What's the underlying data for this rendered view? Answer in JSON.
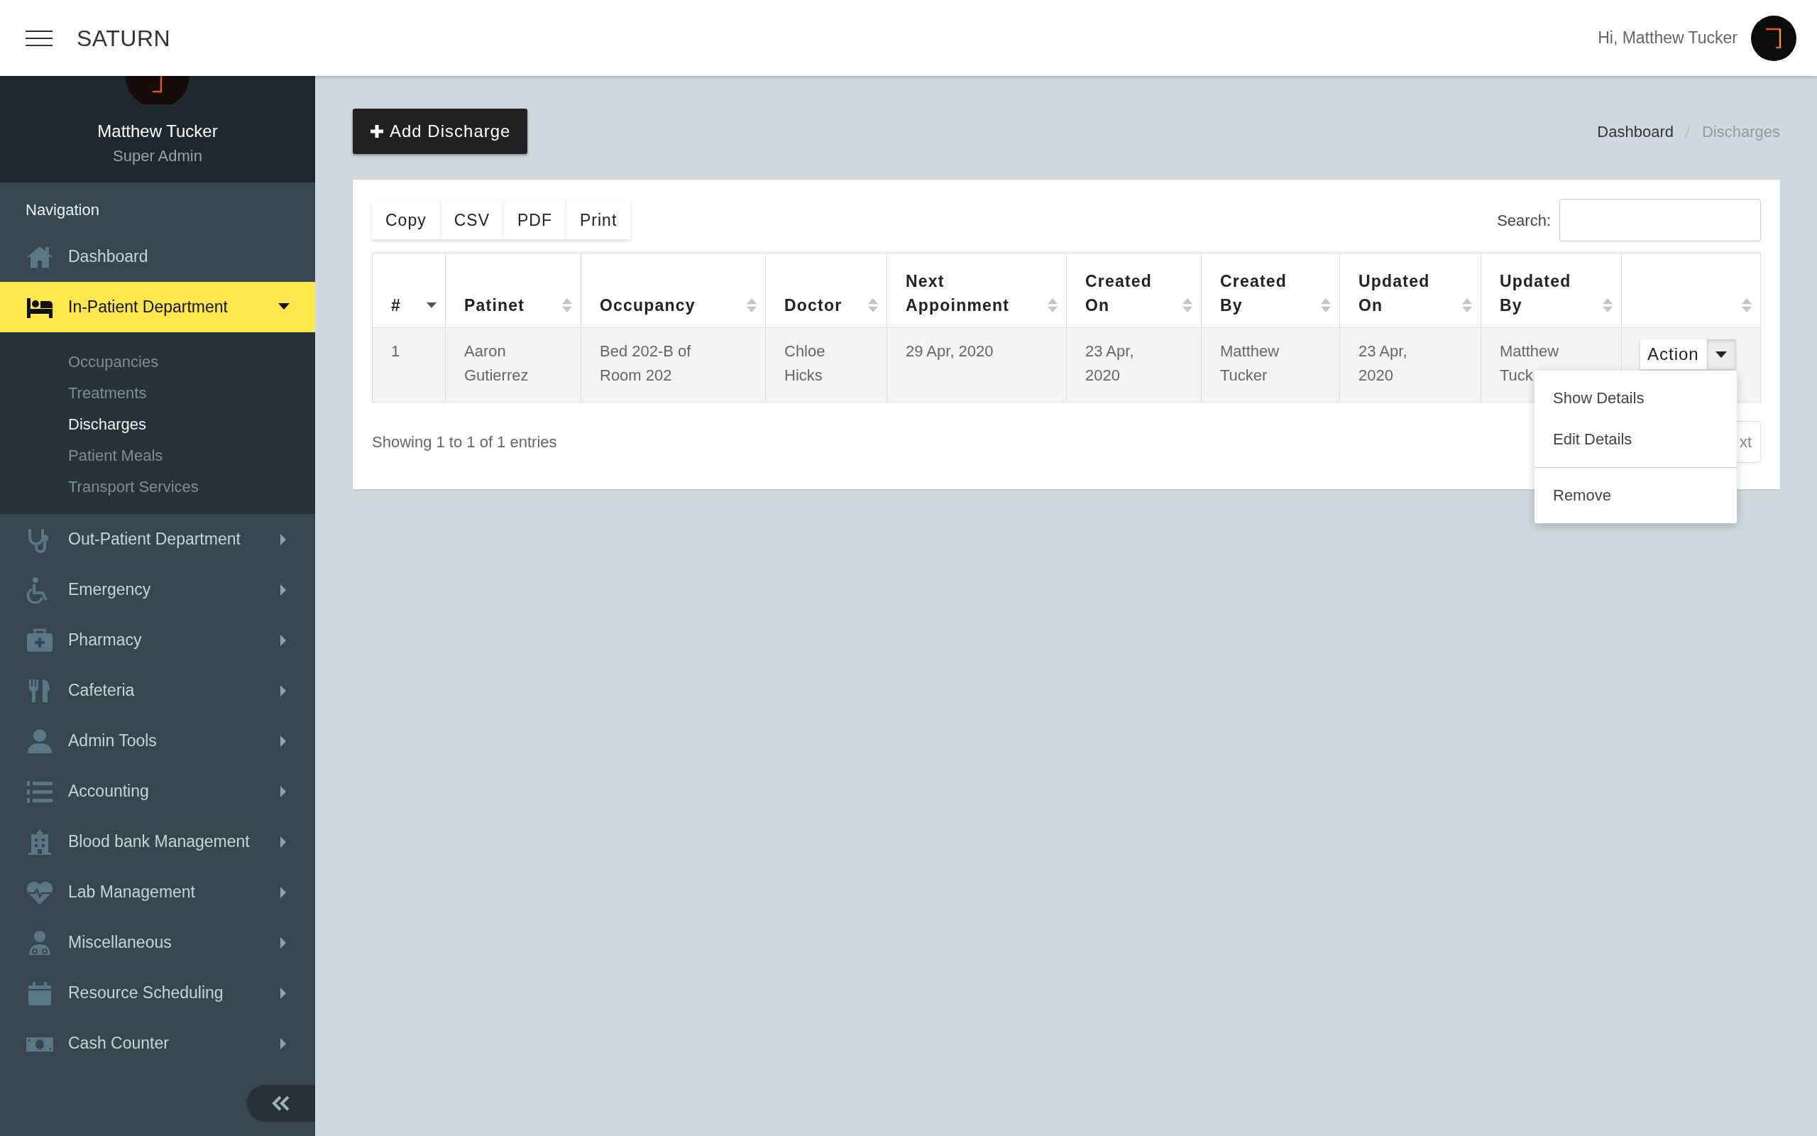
{
  "header": {
    "brand": "SATURN",
    "greeting": "Hi, Matthew Tucker"
  },
  "sidebar": {
    "profile": {
      "name": "Matthew Tucker",
      "role": "Super Admin"
    },
    "heading": "Navigation",
    "items": [
      {
        "label": "Dashboard",
        "kind": "link",
        "selected": false
      },
      {
        "label": "In-Patient Department",
        "kind": "menu",
        "selected": true,
        "expanded": true,
        "children": [
          {
            "label": "Occupancies",
            "selected": false
          },
          {
            "label": "Treatments",
            "selected": false
          },
          {
            "label": "Discharges",
            "selected": true
          },
          {
            "label": "Patient Meals",
            "selected": false
          },
          {
            "label": "Transport Services",
            "selected": false
          }
        ]
      },
      {
        "label": "Out-Patient Department",
        "kind": "menu",
        "selected": false,
        "expanded": false
      },
      {
        "label": "Emergency",
        "kind": "menu",
        "selected": false,
        "expanded": false
      },
      {
        "label": "Pharmacy",
        "kind": "menu",
        "selected": false,
        "expanded": false
      },
      {
        "label": "Cafeteria",
        "kind": "menu",
        "selected": false,
        "expanded": false
      },
      {
        "label": "Admin Tools",
        "kind": "menu",
        "selected": false,
        "expanded": false
      },
      {
        "label": "Accounting",
        "kind": "menu",
        "selected": false,
        "expanded": false
      },
      {
        "label": "Blood bank Management",
        "kind": "menu",
        "selected": false,
        "expanded": false
      },
      {
        "label": "Lab Management",
        "kind": "menu",
        "selected": false,
        "expanded": false
      },
      {
        "label": "Miscellaneous",
        "kind": "menu",
        "selected": false,
        "expanded": false
      },
      {
        "label": "Resource Scheduling",
        "kind": "menu",
        "selected": false,
        "expanded": false
      },
      {
        "label": "Cash Counter",
        "kind": "menu",
        "selected": false,
        "expanded": false
      }
    ]
  },
  "main": {
    "add_button": "Add Discharge",
    "breadcrumb": [
      {
        "label": "Dashboard",
        "current": false
      },
      {
        "label": "Discharges",
        "current": true
      }
    ],
    "table": {
      "export_buttons": [
        "Copy",
        "CSV",
        "PDF",
        "Print"
      ],
      "search_label": "Search:",
      "columns": [
        {
          "label": "#",
          "sorted": true
        },
        {
          "label": "Patinet",
          "sorted": false
        },
        {
          "label": "Occupancy",
          "sorted": false
        },
        {
          "label": "Doctor",
          "sorted": false
        },
        {
          "label": "Next Appoinment",
          "sorted": false
        },
        {
          "label": "Created On",
          "sorted": false
        },
        {
          "label": "Created By",
          "sorted": false
        },
        {
          "label": "Updated On",
          "sorted": false
        },
        {
          "label": "Updated By",
          "sorted": false
        },
        {
          "sorted": false
        }
      ],
      "rows": [
        {
          "cells": [
            "1",
            "Aaron Gutierrez",
            "Bed 202-B of Room 202",
            "Chloe Hicks",
            "29 Apr, 2020",
            "23 Apr, 2020",
            "Matthew Tucker",
            "23 Apr, 2020",
            "Matthew Tuck"
          ],
          "action": "Action",
          "menu_open": true
        }
      ],
      "info": "Showing 1 to 1 of 1 entries",
      "next_button": "xt",
      "action_menu": [
        {
          "kind": "item",
          "label": "Show Details"
        },
        {
          "kind": "item",
          "label": "Edit Details"
        },
        {
          "kind": "divider"
        },
        {
          "kind": "item",
          "label": "Remove"
        }
      ]
    }
  }
}
